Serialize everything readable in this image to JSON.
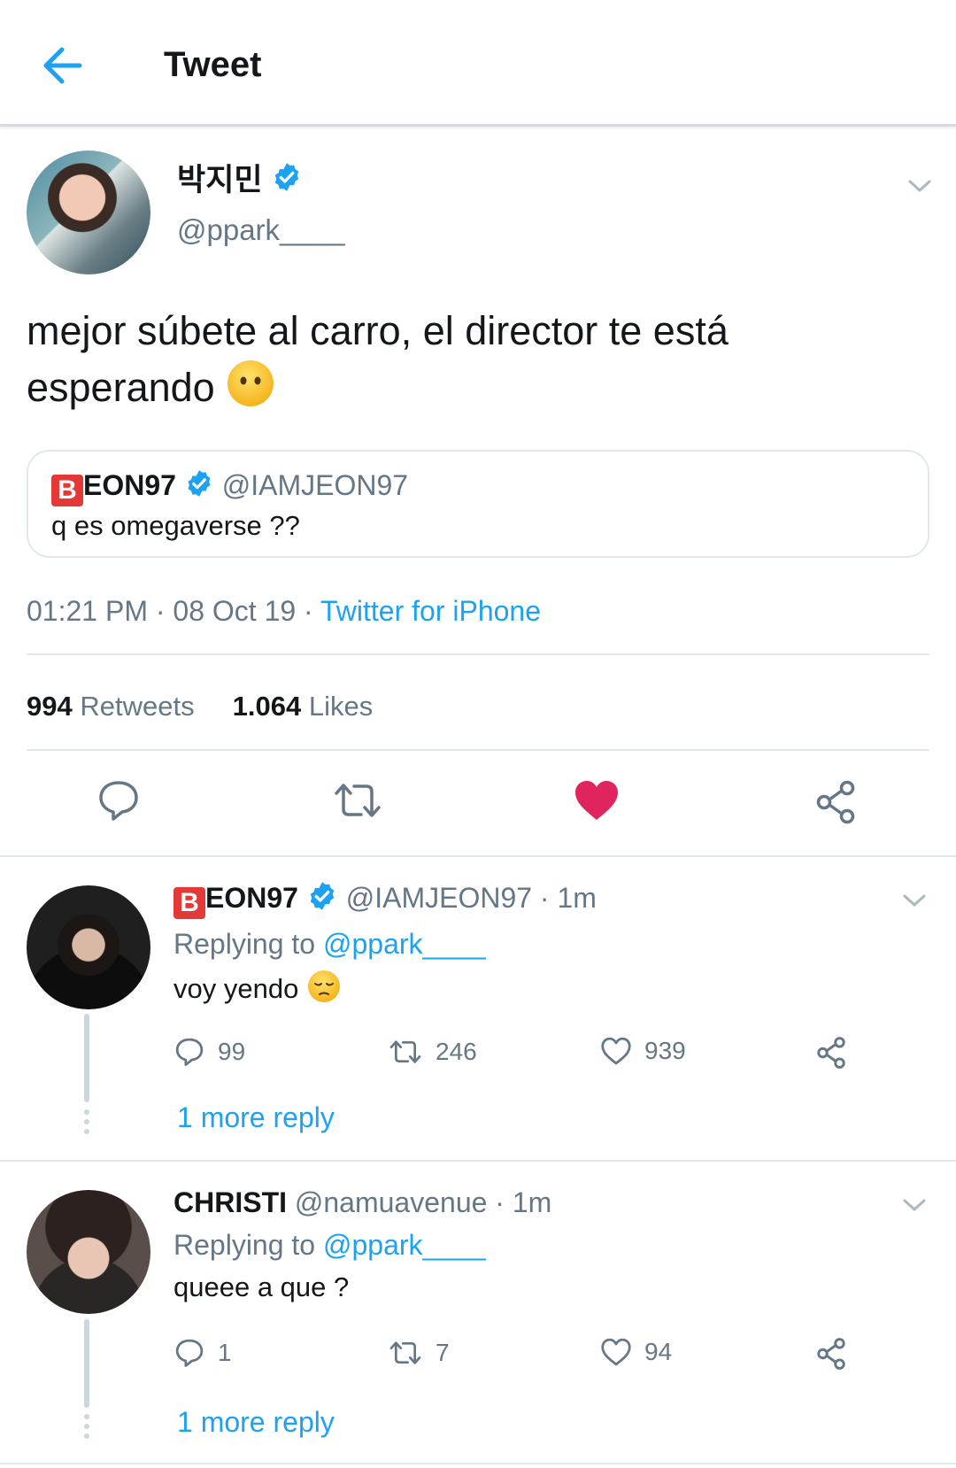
{
  "header": {
    "title": "Tweet"
  },
  "tweet": {
    "author_name": "박지민",
    "author_handle": "@ppark____",
    "text": "mejor súbete al carro, el director te está esperando",
    "quote": {
      "name_badge": "B",
      "name": "EON97",
      "handle": "@IAMJEON97",
      "text": "q es omegaverse ??"
    },
    "time": "01:21 PM",
    "date": "08 Oct 19",
    "source": "Twitter for iPhone",
    "retweets_count": "994",
    "retweets_label": "Retweets",
    "likes_count": "1.064",
    "likes_label": "Likes"
  },
  "colors": {
    "accent": "#1da1f2",
    "like": "#e0245e",
    "muted": "#657786",
    "divider": "#e1e8ed"
  },
  "replies": [
    {
      "name_badge": "B",
      "name": "EON97",
      "handle": "@IAMJEON97",
      "time": "· 1m",
      "replying_label": "Replying to",
      "replying_handle": "@ppark____",
      "text": "voy yendo",
      "reply_count": "99",
      "retweet_count": "246",
      "like_count": "939",
      "more_reply": "1 more reply"
    },
    {
      "name": "CHRISTI",
      "handle": "@namuavenue",
      "time": "· 1m",
      "replying_label": "Replying to",
      "replying_handle": "@ppark____",
      "text": "queee a que ?",
      "reply_count": "1",
      "retweet_count": "7",
      "like_count": "94",
      "more_reply": "1 more reply"
    }
  ]
}
